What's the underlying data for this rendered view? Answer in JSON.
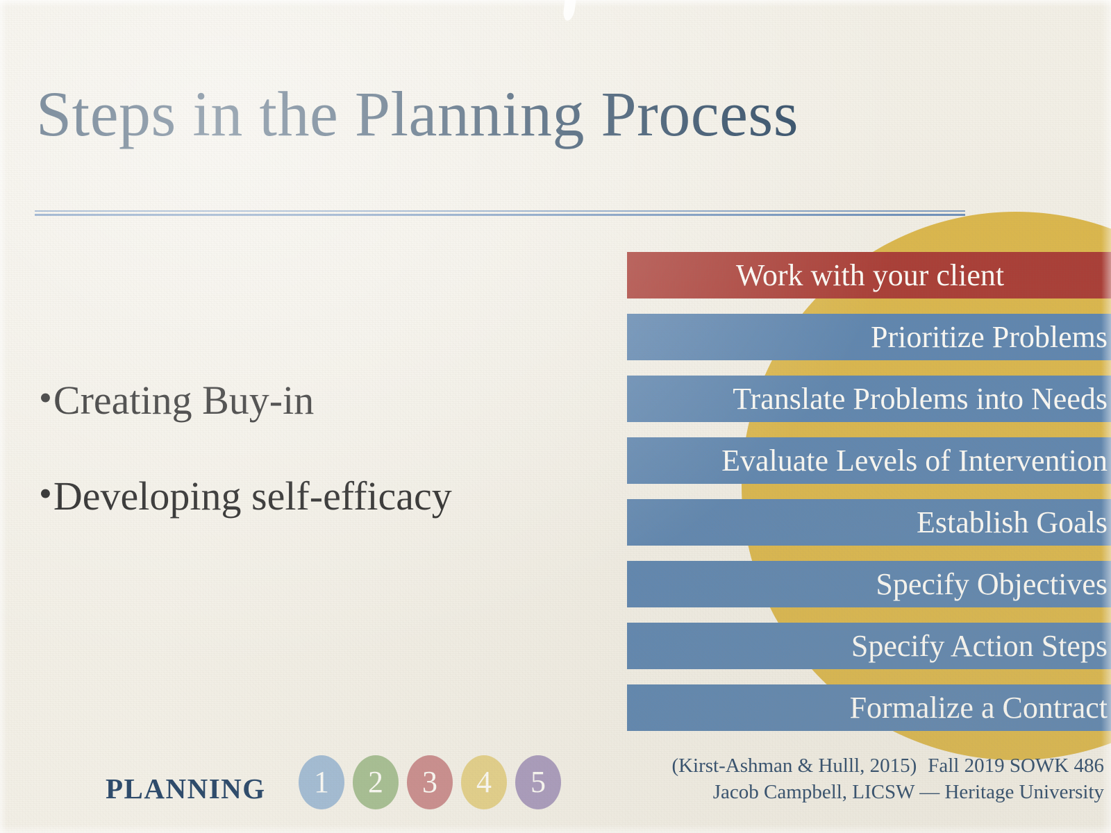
{
  "slide": {
    "title": "Steps in the Planning Process",
    "background_color": "#f2efe6",
    "title_color": "#2a4661",
    "accent_circle_color": "#d9b23f"
  },
  "bullets": [
    {
      "marker": "•",
      "text": "Creating Buy-in"
    },
    {
      "marker": "•",
      "text": "Developing self-efficacy"
    }
  ],
  "steps": {
    "accent_bar_color": "#a93c35",
    "bar_color": "#5d85b0",
    "items": [
      {
        "label": "Work with your client",
        "style": "accent"
      },
      {
        "label": "Prioritize Problems",
        "style": "normal"
      },
      {
        "label": "Translate Problems into Needs",
        "style": "normal"
      },
      {
        "label": "Evaluate Levels of Intervention",
        "style": "normal"
      },
      {
        "label": "Establish Goals",
        "style": "normal"
      },
      {
        "label": "Specify Objectives",
        "style": "normal"
      },
      {
        "label": "Specify Action Steps",
        "style": "normal"
      },
      {
        "label": "Formalize a Contract",
        "style": "normal"
      }
    ]
  },
  "footer": {
    "brand": "PLANNING",
    "dots": [
      {
        "number": "1",
        "color": "#a3bcd4"
      },
      {
        "number": "2",
        "color": "#a7bf93"
      },
      {
        "number": "3",
        "color": "#ca8e8e"
      },
      {
        "number": "4",
        "color": "#e3d08a"
      },
      {
        "number": "5",
        "color": "#a99bbd"
      }
    ],
    "citation": "(Kirst-Ashman & Hulll, 2015)",
    "course": "Fall 2019 SOWK 486",
    "presenter": "Jacob Campbell, LICSW — Heritage University"
  }
}
